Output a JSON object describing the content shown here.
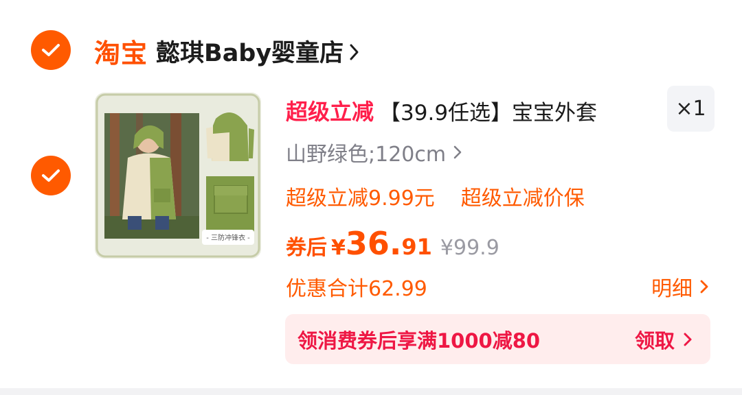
{
  "store": {
    "brand": "淘宝",
    "name": "懿琪Baby婴童店",
    "selected": true
  },
  "item": {
    "selected": true,
    "image_caption": "- 三防冲锋衣 -",
    "tag": "超级立减",
    "title": "【39.9任选】宝宝外套",
    "quantity": "×1",
    "sku": "山野绿色;120cm",
    "promos": [
      "超级立减9.99元",
      "超级立减价保"
    ],
    "after_coupon_label": "券后",
    "currency": "¥",
    "price_int": "36.",
    "price_dec": "91",
    "original_price": "¥99.9",
    "discount_total": "优惠合计62.99",
    "detail_label": "明细"
  },
  "coupon_banner": {
    "text": "领消费券后享满1000减80",
    "action": "领取"
  },
  "colors": {
    "accent": "#ff5000",
    "promo_red": "#ff1f4b",
    "banner_bg": "#ffeded",
    "jacket_green": "#8aa34e"
  },
  "icons": [
    "check-icon",
    "chevron-right-icon"
  ]
}
